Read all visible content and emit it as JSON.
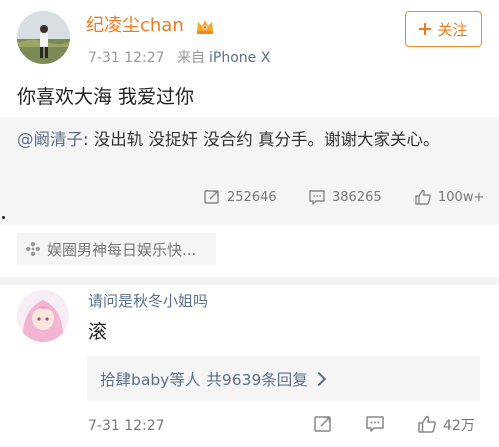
{
  "post": {
    "author_name": "纪凌尘chan",
    "vip_badge_icon": "crown-vip-icon",
    "time": "7-31 12:27",
    "source_prefix": "来自",
    "source_device": "iPhone X",
    "follow_label": "关注",
    "text": "你喜欢大海 我爱过你"
  },
  "repost": {
    "mention": "@阚清子",
    "text": ": 没出轨 没捉奸 没合约 真分手。谢谢大家关心。",
    "stats": [
      {
        "icon": "share-icon",
        "value": "252646"
      },
      {
        "icon": "comment-icon",
        "value": "386265"
      },
      {
        "icon": "like-icon",
        "value": "100w+"
      }
    ]
  },
  "source_chip": {
    "icon": "pinwheel-icon",
    "label": "娱圈男神每日娱乐快..."
  },
  "comment": {
    "question": "请问是秋冬小姐吗",
    "text": "滚",
    "reply_names": "拾肆baby等人",
    "reply_total": "共9639条回复",
    "time": "7-31 12:27",
    "likes": "42万"
  },
  "colors": {
    "accent_orange": "#f07a1a",
    "link_blue": "#5a6f8d",
    "gray_bg": "#f5f5f5"
  }
}
